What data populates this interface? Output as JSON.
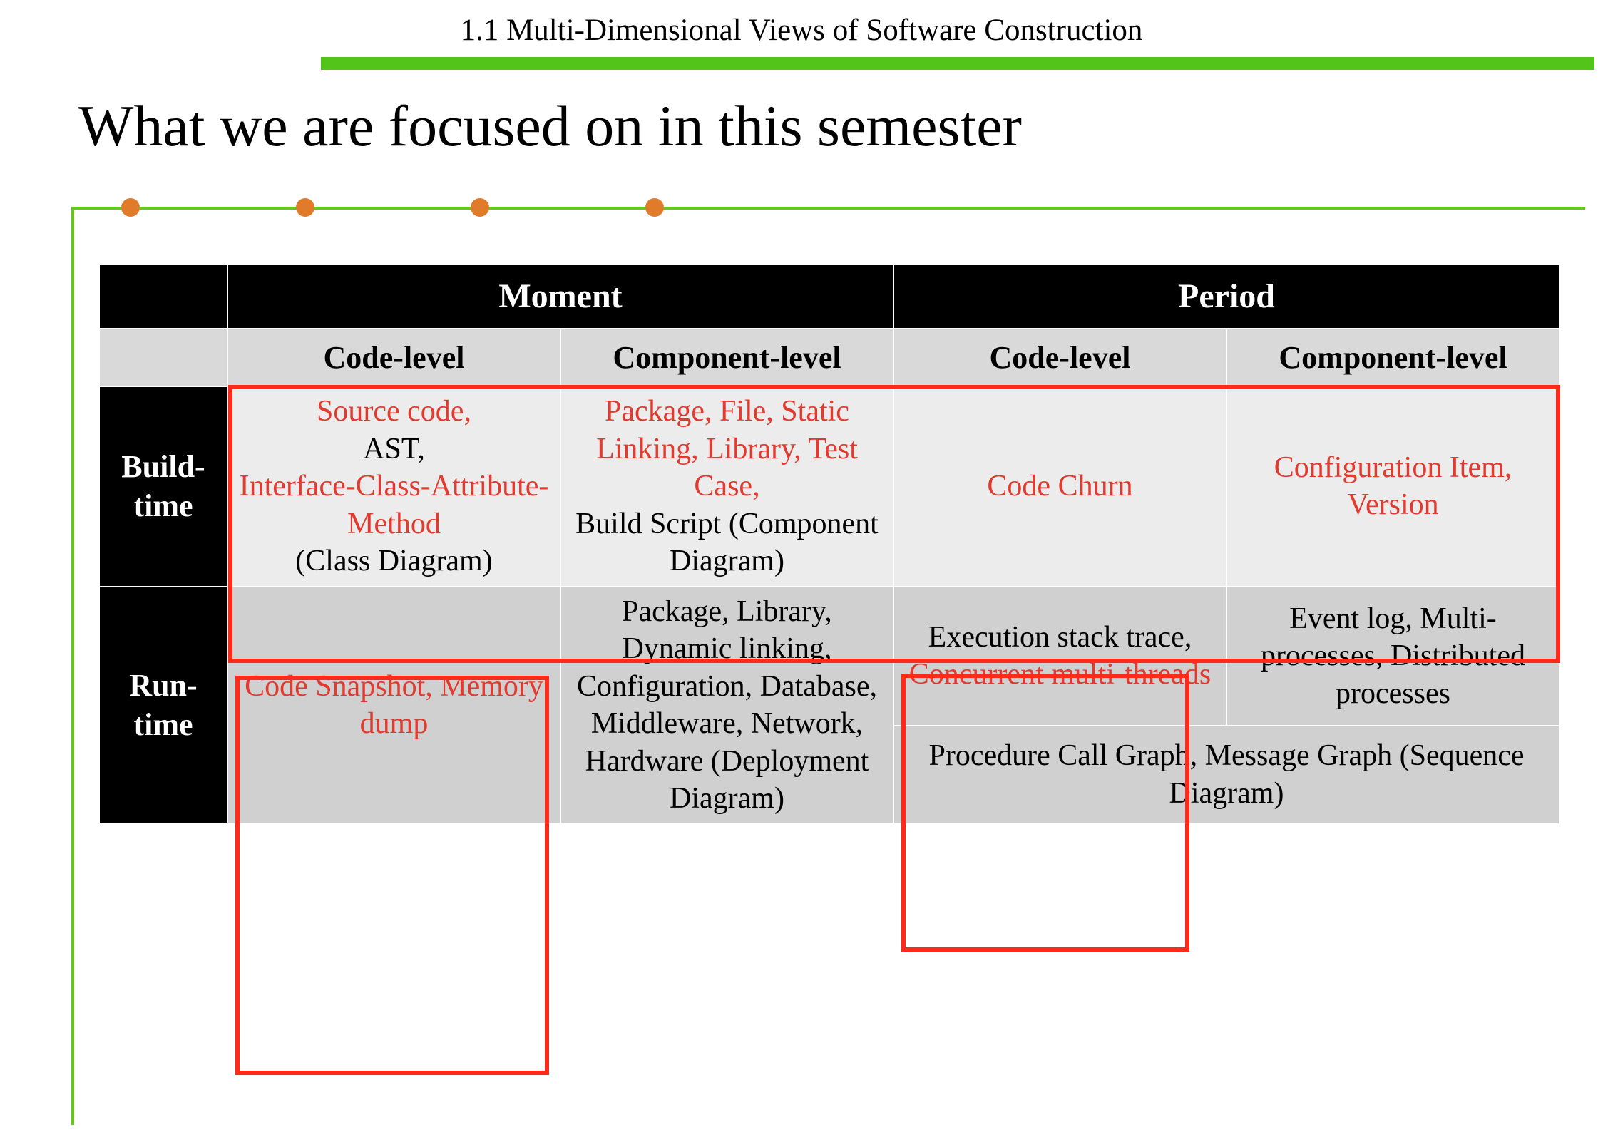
{
  "breadcrumb": "1.1 Multi-Dimensional Views of Software Construction",
  "title": "What we are focused on in this semester",
  "header": {
    "topLeftBlank": "",
    "moment": "Moment",
    "period": "Period",
    "codeLevel": "Code-level",
    "componentLevel": "Component-level"
  },
  "rows": {
    "build": {
      "label": "Build-time",
      "momentCode": {
        "l1": "Source code,",
        "l2": "AST,",
        "l3": "Interface-Class-Attribute-Method",
        "l4": "(Class Diagram)"
      },
      "momentComponent": {
        "l1": "Package, File, Static Linking, Library, Test Case,",
        "l2": "Build Script (Component Diagram)"
      },
      "periodCode": "Code Churn",
      "periodComponent": "Configuration Item, Version"
    },
    "run": {
      "label": "Run-time",
      "momentCode": "Code Snapshot, Memory dump",
      "momentComponent": "Package, Library, Dynamic  linking, Configuration, Database, Middleware, Network, Hardware (Deployment Diagram)",
      "periodCodeTop": {
        "l1": "Execution stack trace,",
        "l2": "Concurrent multi-threads"
      },
      "periodComponentTop": "Event log, Multi-processes, Distributed processes",
      "periodBottom": "Procedure Call Graph, Message Graph (Sequence Diagram)"
    }
  },
  "colors": {
    "accentGreen": "#53c41a",
    "highlightRed": "#ff2a1a",
    "emphasisText": "#e23a2e",
    "dot": "#e07b2c"
  }
}
